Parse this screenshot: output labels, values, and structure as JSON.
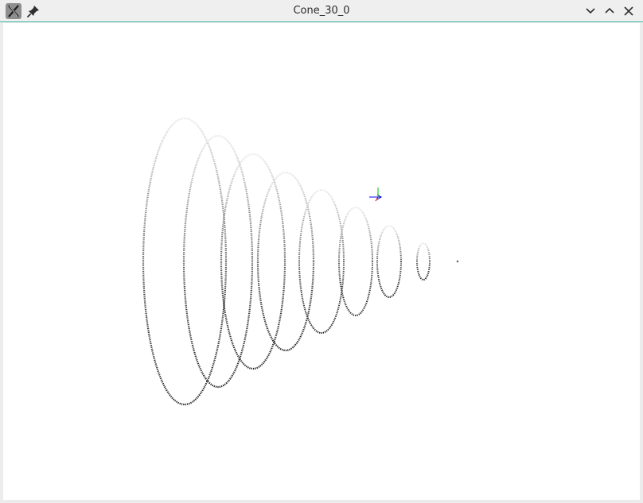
{
  "window": {
    "title": "Cone_30_0"
  },
  "titlebar": {
    "app_icon": "x-window-app-icon",
    "pin_icon": "pin-icon",
    "buttons": [
      {
        "name": "minimize",
        "icon": "chevron-down-icon"
      },
      {
        "name": "maximize",
        "icon": "chevron-up-icon"
      },
      {
        "name": "close",
        "icon": "close-icon"
      }
    ]
  },
  "scene": {
    "background_color": "#ffffff",
    "ring_color": "#333333",
    "ring_count": 8,
    "axes_colors": {
      "x": "#0000ff",
      "y": "#00c000",
      "z": "#c00000"
    }
  }
}
